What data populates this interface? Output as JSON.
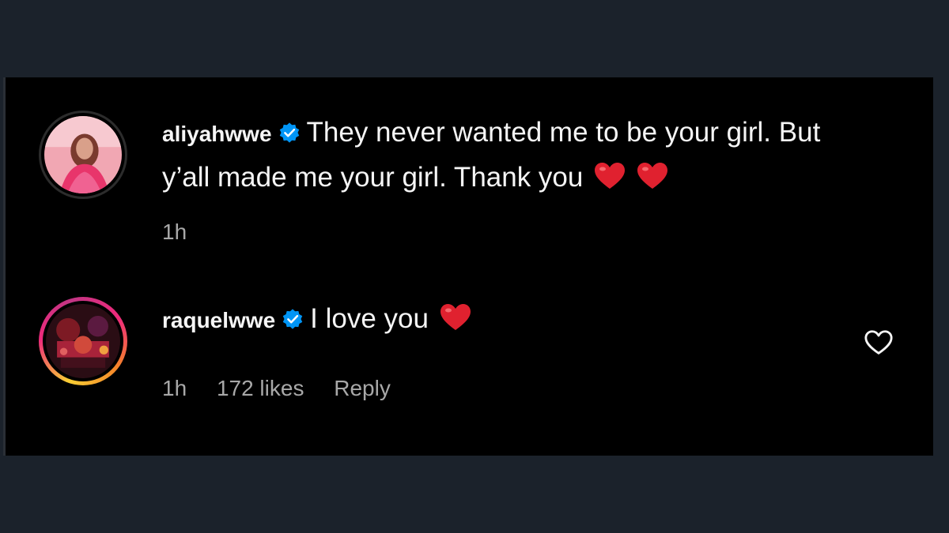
{
  "comments": [
    {
      "username": "aliyahwwe",
      "verified": true,
      "text": "They never wanted me to be your girl. But y’all made me your girl. Thank you",
      "emojis": [
        "red-heart",
        "red-heart"
      ],
      "time": "1h"
    },
    {
      "username": "raquelwwe",
      "verified": true,
      "text": "I love you",
      "emojis": [
        "red-heart"
      ],
      "time": "1h",
      "likes": "172 likes",
      "reply_label": "Reply"
    }
  ],
  "colors": {
    "page_bg": "#1b222b",
    "panel_bg": "#000000",
    "verified_blue": "#0095f6",
    "heart_red": "#e0212f",
    "meta_text": "#a8a8a8"
  },
  "icons": {
    "verified": "verified-badge-icon",
    "heart_emoji": "red-heart-emoji",
    "like": "heart-outline-icon"
  }
}
